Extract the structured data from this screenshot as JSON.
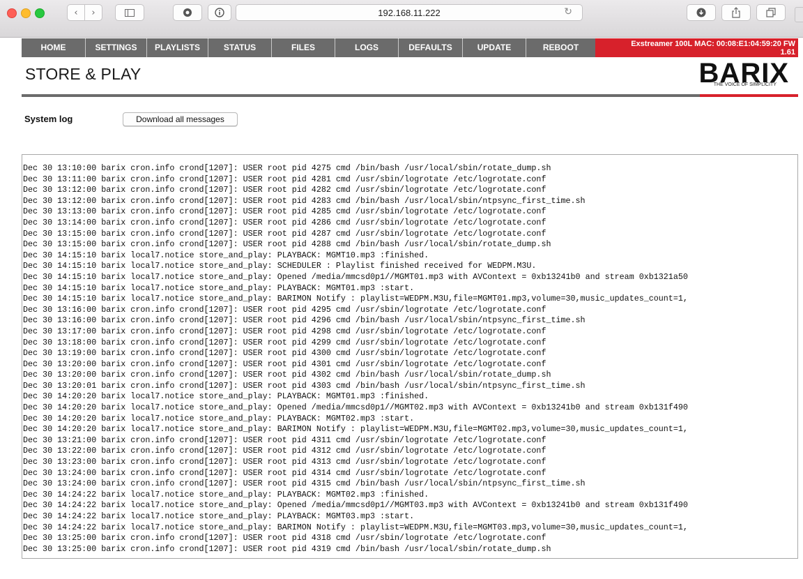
{
  "browser": {
    "url": "192.168.11.222",
    "icons": [
      "close-dot",
      "minimize-dot",
      "zoom-dot",
      "back-icon",
      "forward-icon",
      "sidebar-icon",
      "privacy-icon",
      "info-icon",
      "reload-icon",
      "download-icon",
      "share-icon",
      "tabs-icon"
    ]
  },
  "nav": {
    "items": [
      "HOME",
      "SETTINGS",
      "PLAYLISTS",
      "STATUS",
      "FILES",
      "LOGS",
      "DEFAULTS",
      "UPDATE",
      "REBOOT"
    ],
    "device_line1": "Exstreamer 100L  MAC: 00:08:E1:04:59:20  FW",
    "device_line2": "1.61"
  },
  "header": {
    "title": "STORE & PLAY",
    "logo": "BARIX",
    "tagline": "THE VOICE OF SIMPLICITY"
  },
  "log": {
    "label": "System log",
    "download_button": "Download all messages",
    "lines": [
      "Dec 30 13:10:00 barix cron.info crond[1207]: USER root pid 4275 cmd /bin/bash /usr/local/sbin/rotate_dump.sh",
      "Dec 30 13:11:00 barix cron.info crond[1207]: USER root pid 4281 cmd /usr/sbin/logrotate /etc/logrotate.conf",
      "Dec 30 13:12:00 barix cron.info crond[1207]: USER root pid 4282 cmd /usr/sbin/logrotate /etc/logrotate.conf",
      "Dec 30 13:12:00 barix cron.info crond[1207]: USER root pid 4283 cmd /bin/bash /usr/local/sbin/ntpsync_first_time.sh",
      "Dec 30 13:13:00 barix cron.info crond[1207]: USER root pid 4285 cmd /usr/sbin/logrotate /etc/logrotate.conf",
      "Dec 30 13:14:00 barix cron.info crond[1207]: USER root pid 4286 cmd /usr/sbin/logrotate /etc/logrotate.conf",
      "Dec 30 13:15:00 barix cron.info crond[1207]: USER root pid 4287 cmd /usr/sbin/logrotate /etc/logrotate.conf",
      "Dec 30 13:15:00 barix cron.info crond[1207]: USER root pid 4288 cmd /bin/bash /usr/local/sbin/rotate_dump.sh",
      "Dec 30 14:15:10 barix local7.notice store_and_play: PLAYBACK: MGMT10.mp3 :finished.",
      "Dec 30 14:15:10 barix local7.notice store_and_play: SCHEDULER : Playlist finished received for WEDPM.M3U.",
      "Dec 30 14:15:10 barix local7.notice store_and_play: Opened /media/mmcsd0p1//MGMT01.mp3 with AVContext = 0xb13241b0 and stream 0xb1321a50",
      "Dec 30 14:15:10 barix local7.notice store_and_play: PLAYBACK: MGMT01.mp3 :start.",
      "Dec 30 14:15:10 barix local7.notice store_and_play: BARIMON Notify : playlist=WEDPM.M3U,file=MGMT01.mp3,volume=30,music_updates_count=1,",
      "Dec 30 13:16:00 barix cron.info crond[1207]: USER root pid 4295 cmd /usr/sbin/logrotate /etc/logrotate.conf",
      "Dec 30 13:16:00 barix cron.info crond[1207]: USER root pid 4296 cmd /bin/bash /usr/local/sbin/ntpsync_first_time.sh",
      "Dec 30 13:17:00 barix cron.info crond[1207]: USER root pid 4298 cmd /usr/sbin/logrotate /etc/logrotate.conf",
      "Dec 30 13:18:00 barix cron.info crond[1207]: USER root pid 4299 cmd /usr/sbin/logrotate /etc/logrotate.conf",
      "Dec 30 13:19:00 barix cron.info crond[1207]: USER root pid 4300 cmd /usr/sbin/logrotate /etc/logrotate.conf",
      "Dec 30 13:20:00 barix cron.info crond[1207]: USER root pid 4301 cmd /usr/sbin/logrotate /etc/logrotate.conf",
      "Dec 30 13:20:00 barix cron.info crond[1207]: USER root pid 4302 cmd /bin/bash /usr/local/sbin/rotate_dump.sh",
      "Dec 30 13:20:01 barix cron.info crond[1207]: USER root pid 4303 cmd /bin/bash /usr/local/sbin/ntpsync_first_time.sh",
      "Dec 30 14:20:20 barix local7.notice store_and_play: PLAYBACK: MGMT01.mp3 :finished.",
      "Dec 30 14:20:20 barix local7.notice store_and_play: Opened /media/mmcsd0p1//MGMT02.mp3 with AVContext = 0xb13241b0 and stream 0xb131f490",
      "Dec 30 14:20:20 barix local7.notice store_and_play: PLAYBACK: MGMT02.mp3 :start.",
      "Dec 30 14:20:20 barix local7.notice store_and_play: BARIMON Notify : playlist=WEDPM.M3U,file=MGMT02.mp3,volume=30,music_updates_count=1,",
      "Dec 30 13:21:00 barix cron.info crond[1207]: USER root pid 4311 cmd /usr/sbin/logrotate /etc/logrotate.conf",
      "Dec 30 13:22:00 barix cron.info crond[1207]: USER root pid 4312 cmd /usr/sbin/logrotate /etc/logrotate.conf",
      "Dec 30 13:23:00 barix cron.info crond[1207]: USER root pid 4313 cmd /usr/sbin/logrotate /etc/logrotate.conf",
      "Dec 30 13:24:00 barix cron.info crond[1207]: USER root pid 4314 cmd /usr/sbin/logrotate /etc/logrotate.conf",
      "Dec 30 13:24:00 barix cron.info crond[1207]: USER root pid 4315 cmd /bin/bash /usr/local/sbin/ntpsync_first_time.sh",
      "Dec 30 14:24:22 barix local7.notice store_and_play: PLAYBACK: MGMT02.mp3 :finished.",
      "Dec 30 14:24:22 barix local7.notice store_and_play: Opened /media/mmcsd0p1//MGMT03.mp3 with AVContext = 0xb13241b0 and stream 0xb131f490",
      "Dec 30 14:24:22 barix local7.notice store_and_play: PLAYBACK: MGMT03.mp3 :start.",
      "Dec 30 14:24:22 barix local7.notice store_and_play: BARIMON Notify : playlist=WEDPM.M3U,file=MGMT03.mp3,volume=30,music_updates_count=1,",
      "Dec 30 13:25:00 barix cron.info crond[1207]: USER root pid 4318 cmd /usr/sbin/logrotate /etc/logrotate.conf",
      "Dec 30 13:25:00 barix cron.info crond[1207]: USER root pid 4319 cmd /bin/bash /usr/local/sbin/rotate_dump.sh"
    ]
  }
}
